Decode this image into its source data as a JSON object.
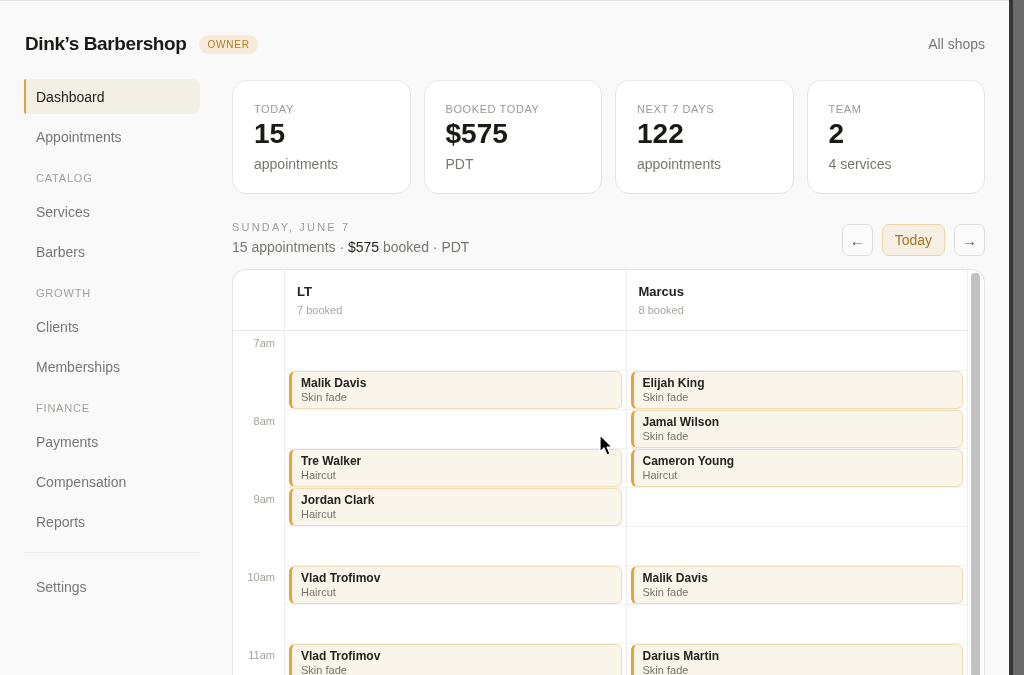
{
  "header": {
    "title": "Dink’s Barbershop",
    "role_badge": "OWNER",
    "shops_link": "All shops"
  },
  "sidebar": {
    "items": [
      {
        "kind": "link",
        "label": "Dashboard",
        "selected": true
      },
      {
        "kind": "link",
        "label": "Appointments",
        "selected": false
      },
      {
        "kind": "section",
        "label": "CATALOG"
      },
      {
        "kind": "link",
        "label": "Services",
        "selected": false
      },
      {
        "kind": "link",
        "label": "Barbers",
        "selected": false
      },
      {
        "kind": "section",
        "label": "GROWTH"
      },
      {
        "kind": "link",
        "label": "Clients",
        "selected": false
      },
      {
        "kind": "link",
        "label": "Memberships",
        "selected": false
      },
      {
        "kind": "section",
        "label": "FINANCE"
      },
      {
        "kind": "link",
        "label": "Payments",
        "selected": false
      },
      {
        "kind": "link",
        "label": "Compensation",
        "selected": false
      },
      {
        "kind": "link",
        "label": "Reports",
        "selected": false
      },
      {
        "kind": "divider"
      },
      {
        "kind": "link",
        "label": "Settings",
        "selected": false
      }
    ]
  },
  "stats": [
    {
      "label": "TODAY",
      "value": "15",
      "caption": "appointments"
    },
    {
      "label": "BOOKED TODAY",
      "value": "$575",
      "caption": "PDT"
    },
    {
      "label": "NEXT 7 DAYS",
      "value": "122",
      "caption": "appointments"
    },
    {
      "label": "TEAM",
      "value": "2",
      "caption": "4 services"
    }
  ],
  "day": {
    "heading": "SUNDAY, JUNE 7",
    "summary": "15 appointments · **$575** booked · PDT",
    "buttons": [
      {
        "kind": "prev",
        "label": "←"
      },
      {
        "kind": "today",
        "label": "Today"
      },
      {
        "kind": "next",
        "label": "→"
      }
    ]
  },
  "calendar": {
    "hours": [
      "7am",
      "8am",
      "9am",
      "10am",
      "11am"
    ],
    "barbers": [
      {
        "name": "LT",
        "count": "7 booked",
        "slots": [
          {
            "booked": false
          },
          {
            "booked": true,
            "client": "Malik Davis",
            "service": "Skin fade"
          },
          {
            "booked": false
          },
          {
            "booked": true,
            "client": "Tre Walker",
            "service": "Haircut"
          },
          {
            "booked": true,
            "client": "Jordan Clark",
            "service": "Haircut"
          },
          {
            "booked": false
          },
          {
            "booked": true,
            "client": "Vlad Trofimov",
            "service": "Haircut"
          },
          {
            "booked": false
          },
          {
            "booked": true,
            "client": "Vlad Trofimov",
            "service": "Skin fade"
          }
        ]
      },
      {
        "name": "Marcus",
        "count": "8 booked",
        "slots": [
          {
            "booked": false
          },
          {
            "booked": true,
            "client": "Elijah King",
            "service": "Skin fade"
          },
          {
            "booked": true,
            "client": "Jamal Wilson",
            "service": "Skin fade"
          },
          {
            "booked": true,
            "client": "Cameron Young",
            "service": "Haircut"
          },
          {
            "booked": false
          },
          {
            "booked": false
          },
          {
            "booked": true,
            "client": "Malik Davis",
            "service": "Skin fade"
          },
          {
            "booked": false
          },
          {
            "booked": true,
            "client": "Darius Martin",
            "service": "Skin fade"
          }
        ]
      }
    ]
  }
}
